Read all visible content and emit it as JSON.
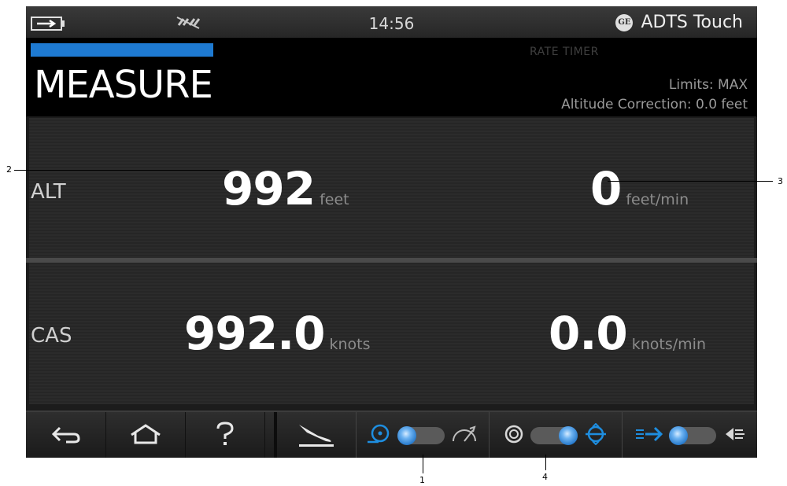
{
  "status_bar": {
    "time": "14:56",
    "app_name": "ADTS Touch",
    "logo_text": "GE"
  },
  "header": {
    "progress_fraction": 0.5,
    "rate_timer_label": "RATE TIMER",
    "title": "MEASURE",
    "limits": "Limits: MAX",
    "altitude_correction": "Altitude Correction: 0.0 feet"
  },
  "measurements": [
    {
      "label": "ALT",
      "value": "992",
      "unit": "feet",
      "rate_value": "0",
      "rate_unit": "feet/min"
    },
    {
      "label": "CAS",
      "value": "992.0",
      "unit": "knots",
      "rate_value": "0.0",
      "rate_unit": "knots/min"
    }
  ],
  "toolbar": {
    "buttons": [
      "back-icon",
      "home-icon",
      "help-icon",
      "aircraft-landing-icon"
    ],
    "toggles": [
      {
        "left_icon": "leak-test-icon",
        "right_icon": "gauge-rate-icon",
        "state": "left"
      },
      {
        "left_icon": "gauge-icon",
        "right_icon": "control-icon",
        "state": "right"
      },
      {
        "left_icon": "aircraft-forward-icon",
        "right_icon": "aircraft-reverse-icon",
        "state": "left"
      }
    ]
  },
  "callouts": [
    "1",
    "2",
    "3",
    "4"
  ],
  "colors": {
    "accent": "#1e7ad1",
    "background": "#1c1c1c"
  }
}
